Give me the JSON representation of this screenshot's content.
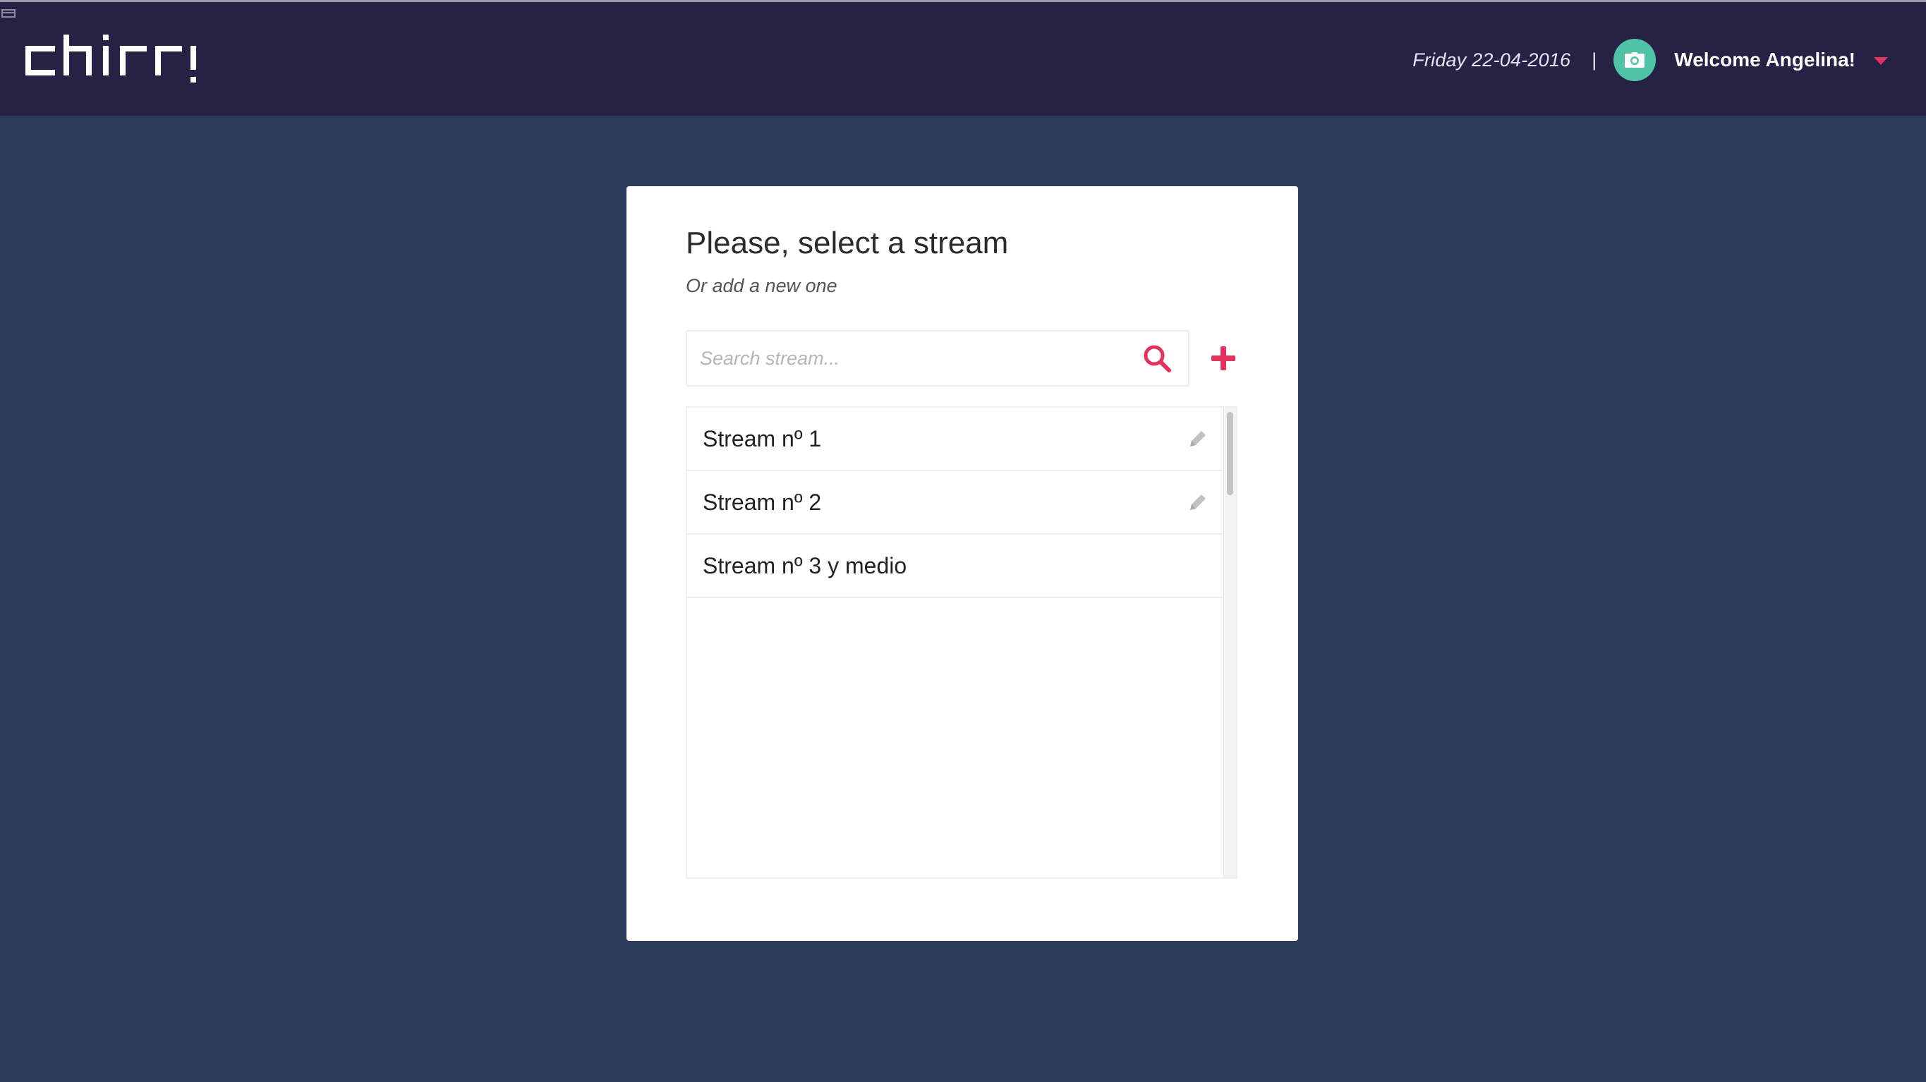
{
  "app": {
    "logo_text": "chirr!"
  },
  "header": {
    "date": "Friday 22-04-2016",
    "divider": "|",
    "welcome": "Welcome Angelina!",
    "avatar_icon": "camera-icon",
    "menu_icon": "caret-down-icon"
  },
  "card": {
    "title": "Please, select a stream",
    "subtitle": "Or add a new one",
    "search": {
      "placeholder": "Search stream...",
      "value": "",
      "icon": "search-icon"
    },
    "add_icon": "plus-icon",
    "streams": [
      {
        "label": "Stream nº 1",
        "editable": true
      },
      {
        "label": "Stream nº 2",
        "editable": true
      },
      {
        "label": "Stream nº 3 y medio",
        "editable": false
      }
    ]
  },
  "colors": {
    "header_bg": "#262145",
    "page_bg": "#2c3c5b",
    "accent": "#e0335e",
    "avatar": "#4fc3a6",
    "edit_icon": "#c2c2c2"
  }
}
